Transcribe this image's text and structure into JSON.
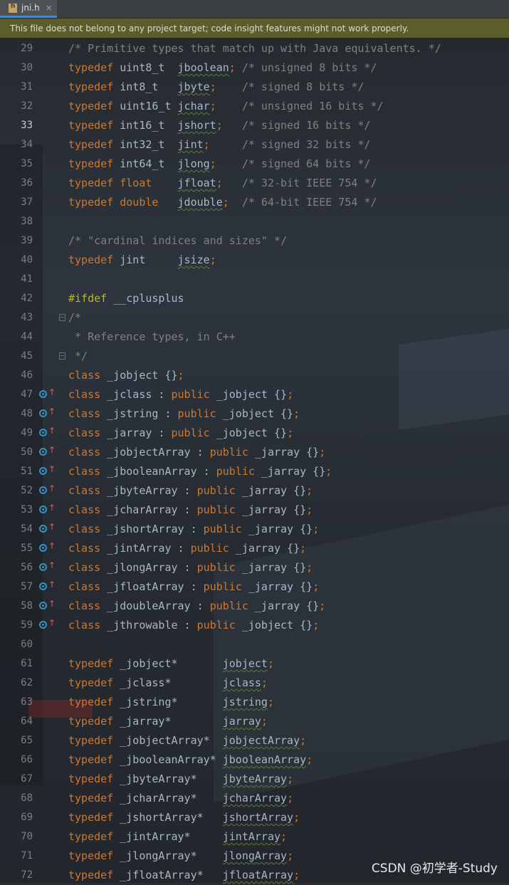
{
  "tab": {
    "title": "jni.h",
    "close": "×"
  },
  "banner": {
    "text": "This file does not belong to any project target; code insight features might not work properly."
  },
  "watermark": "CSDN @初学者-Study",
  "current_line": 33,
  "lines": [
    {
      "n": "29",
      "parts": [
        [
          "cm",
          "/* Primitive types that match up with Java equivalents. */"
        ]
      ]
    },
    {
      "n": "30",
      "parts": [
        [
          "kw",
          "typedef"
        ],
        [
          "ty",
          " uint8_t  "
        ],
        [
          "id",
          "jboolean"
        ],
        [
          "semi",
          ";"
        ],
        [
          "cm",
          " /* unsigned 8 bits */"
        ]
      ]
    },
    {
      "n": "31",
      "parts": [
        [
          "kw",
          "typedef"
        ],
        [
          "ty",
          " int8_t   "
        ],
        [
          "id",
          "jbyte"
        ],
        [
          "semi",
          ";"
        ],
        [
          "cm",
          "    /* signed 8 bits */"
        ]
      ]
    },
    {
      "n": "32",
      "parts": [
        [
          "kw",
          "typedef"
        ],
        [
          "ty",
          " uint16_t "
        ],
        [
          "id",
          "jchar"
        ],
        [
          "semi",
          ";"
        ],
        [
          "cm",
          "    /* unsigned 16 bits */"
        ]
      ]
    },
    {
      "n": "33",
      "parts": [
        [
          "kw",
          "typedef"
        ],
        [
          "ty",
          " int16_t  "
        ],
        [
          "id",
          "jshort"
        ],
        [
          "semi",
          ";"
        ],
        [
          "cm",
          "   /* signed 16 bits */"
        ]
      ]
    },
    {
      "n": "34",
      "parts": [
        [
          "kw",
          "typedef"
        ],
        [
          "ty",
          " int32_t  "
        ],
        [
          "id",
          "jint"
        ],
        [
          "semi",
          ";"
        ],
        [
          "cm",
          "     /* signed 32 bits */"
        ]
      ]
    },
    {
      "n": "35",
      "parts": [
        [
          "kw",
          "typedef"
        ],
        [
          "ty",
          " int64_t  "
        ],
        [
          "id",
          "jlong"
        ],
        [
          "semi",
          ";"
        ],
        [
          "cm",
          "    /* signed 64 bits */"
        ]
      ]
    },
    {
      "n": "36",
      "parts": [
        [
          "kw",
          "typedef"
        ],
        [
          "kw",
          " float    "
        ],
        [
          "id",
          "jfloat"
        ],
        [
          "semi",
          ";"
        ],
        [
          "cm",
          "   /* 32-bit IEEE 754 */"
        ]
      ]
    },
    {
      "n": "37",
      "parts": [
        [
          "kw",
          "typedef"
        ],
        [
          "kw",
          " double   "
        ],
        [
          "id",
          "jdouble"
        ],
        [
          "semi",
          ";"
        ],
        [
          "cm",
          "  /* 64-bit IEEE 754 */"
        ]
      ]
    },
    {
      "n": "38",
      "parts": []
    },
    {
      "n": "39",
      "parts": [
        [
          "cm",
          "/* \"cardinal indices and sizes\" */"
        ]
      ]
    },
    {
      "n": "40",
      "parts": [
        [
          "kw",
          "typedef"
        ],
        [
          "ty",
          " jint     "
        ],
        [
          "id",
          "jsize"
        ],
        [
          "semi",
          ";"
        ]
      ]
    },
    {
      "n": "41",
      "parts": []
    },
    {
      "n": "42",
      "parts": [
        [
          "pp",
          "#ifdef"
        ],
        [
          "ty",
          " __cplusplus"
        ]
      ]
    },
    {
      "n": "43",
      "fold": true,
      "parts": [
        [
          "cm",
          "/*"
        ]
      ]
    },
    {
      "n": "44",
      "parts": [
        [
          "cm",
          " * Reference types, in C++"
        ]
      ]
    },
    {
      "n": "45",
      "fold": true,
      "parts": [
        [
          "cm",
          " */"
        ]
      ]
    },
    {
      "n": "46",
      "parts": [
        [
          "kw",
          "class"
        ],
        [
          "ty",
          " _jobject {}"
        ],
        [
          "semi",
          ";"
        ]
      ]
    },
    {
      "n": "47",
      "impl": true,
      "parts": [
        [
          "kw",
          "class"
        ],
        [
          "ty",
          " _jclass : "
        ],
        [
          "kw",
          "public"
        ],
        [
          "ty",
          " _jobject {}"
        ],
        [
          "semi",
          ";"
        ]
      ]
    },
    {
      "n": "48",
      "impl": true,
      "parts": [
        [
          "kw",
          "class"
        ],
        [
          "ty",
          " _jstring : "
        ],
        [
          "kw",
          "public"
        ],
        [
          "ty",
          " _jobject {}"
        ],
        [
          "semi",
          ";"
        ]
      ]
    },
    {
      "n": "49",
      "impl": true,
      "parts": [
        [
          "kw",
          "class"
        ],
        [
          "ty",
          " _jarray : "
        ],
        [
          "kw",
          "public"
        ],
        [
          "ty",
          " _jobject {}"
        ],
        [
          "semi",
          ";"
        ]
      ]
    },
    {
      "n": "50",
      "impl": true,
      "parts": [
        [
          "kw",
          "class"
        ],
        [
          "ty",
          " _jobjectArray : "
        ],
        [
          "kw",
          "public"
        ],
        [
          "ty",
          " _jarray {}"
        ],
        [
          "semi",
          ";"
        ]
      ]
    },
    {
      "n": "51",
      "impl": true,
      "parts": [
        [
          "kw",
          "class"
        ],
        [
          "ty",
          " _jbooleanArray : "
        ],
        [
          "kw",
          "public"
        ],
        [
          "ty",
          " _jarray {}"
        ],
        [
          "semi",
          ";"
        ]
      ]
    },
    {
      "n": "52",
      "impl": true,
      "parts": [
        [
          "kw",
          "class"
        ],
        [
          "ty",
          " _jbyteArray : "
        ],
        [
          "kw",
          "public"
        ],
        [
          "ty",
          " _jarray {}"
        ],
        [
          "semi",
          ";"
        ]
      ]
    },
    {
      "n": "53",
      "impl": true,
      "parts": [
        [
          "kw",
          "class"
        ],
        [
          "ty",
          " _jcharArray : "
        ],
        [
          "kw",
          "public"
        ],
        [
          "ty",
          " _jarray {}"
        ],
        [
          "semi",
          ";"
        ]
      ]
    },
    {
      "n": "54",
      "impl": true,
      "parts": [
        [
          "kw",
          "class"
        ],
        [
          "ty",
          " _jshortArray : "
        ],
        [
          "kw",
          "public"
        ],
        [
          "ty",
          " _jarray {}"
        ],
        [
          "semi",
          ";"
        ]
      ]
    },
    {
      "n": "55",
      "impl": true,
      "parts": [
        [
          "kw",
          "class"
        ],
        [
          "ty",
          " _jintArray : "
        ],
        [
          "kw",
          "public"
        ],
        [
          "ty",
          " _jarray {}"
        ],
        [
          "semi",
          ";"
        ]
      ]
    },
    {
      "n": "56",
      "impl": true,
      "parts": [
        [
          "kw",
          "class"
        ],
        [
          "ty",
          " _jlongArray : "
        ],
        [
          "kw",
          "public"
        ],
        [
          "ty",
          " _jarray {}"
        ],
        [
          "semi",
          ";"
        ]
      ]
    },
    {
      "n": "57",
      "impl": true,
      "parts": [
        [
          "kw",
          "class"
        ],
        [
          "ty",
          " _jfloatArray : "
        ],
        [
          "kw",
          "public"
        ],
        [
          "ty",
          " _jarray {}"
        ],
        [
          "semi",
          ";"
        ]
      ]
    },
    {
      "n": "58",
      "impl": true,
      "parts": [
        [
          "kw",
          "class"
        ],
        [
          "ty",
          " _jdoubleArray : "
        ],
        [
          "kw",
          "public"
        ],
        [
          "ty",
          " _jarray {}"
        ],
        [
          "semi",
          ";"
        ]
      ]
    },
    {
      "n": "59",
      "impl": true,
      "parts": [
        [
          "kw",
          "class"
        ],
        [
          "ty",
          " _jthrowable : "
        ],
        [
          "kw",
          "public"
        ],
        [
          "ty",
          " _jobject {}"
        ],
        [
          "semi",
          ";"
        ]
      ]
    },
    {
      "n": "60",
      "parts": []
    },
    {
      "n": "61",
      "parts": [
        [
          "kw",
          "typedef"
        ],
        [
          "ty",
          " _jobject*       "
        ],
        [
          "id",
          "jobject"
        ],
        [
          "semi",
          ";"
        ]
      ]
    },
    {
      "n": "62",
      "parts": [
        [
          "kw",
          "typedef"
        ],
        [
          "ty",
          " _jclass*        "
        ],
        [
          "id",
          "jclass"
        ],
        [
          "semi",
          ";"
        ]
      ]
    },
    {
      "n": "63",
      "parts": [
        [
          "kw",
          "typedef"
        ],
        [
          "ty",
          " _jstring*       "
        ],
        [
          "id",
          "jstring"
        ],
        [
          "semi",
          ";"
        ]
      ]
    },
    {
      "n": "64",
      "parts": [
        [
          "kw",
          "typedef"
        ],
        [
          "ty",
          " _jarray*        "
        ],
        [
          "id",
          "jarray"
        ],
        [
          "semi",
          ";"
        ]
      ]
    },
    {
      "n": "65",
      "parts": [
        [
          "kw",
          "typedef"
        ],
        [
          "ty",
          " _jobjectArray*  "
        ],
        [
          "id",
          "jobjectArray"
        ],
        [
          "semi",
          ";"
        ]
      ]
    },
    {
      "n": "66",
      "parts": [
        [
          "kw",
          "typedef"
        ],
        [
          "ty",
          " _jbooleanArray* "
        ],
        [
          "id",
          "jbooleanArray"
        ],
        [
          "semi",
          ";"
        ]
      ]
    },
    {
      "n": "67",
      "parts": [
        [
          "kw",
          "typedef"
        ],
        [
          "ty",
          " _jbyteArray*    "
        ],
        [
          "id",
          "jbyteArray"
        ],
        [
          "semi",
          ";"
        ]
      ]
    },
    {
      "n": "68",
      "parts": [
        [
          "kw",
          "typedef"
        ],
        [
          "ty",
          " _jcharArray*    "
        ],
        [
          "id",
          "jcharArray"
        ],
        [
          "semi",
          ";"
        ]
      ]
    },
    {
      "n": "69",
      "parts": [
        [
          "kw",
          "typedef"
        ],
        [
          "ty",
          " _jshortArray*   "
        ],
        [
          "id",
          "jshortArray"
        ],
        [
          "semi",
          ";"
        ]
      ]
    },
    {
      "n": "70",
      "parts": [
        [
          "kw",
          "typedef"
        ],
        [
          "ty",
          " _jintArray*     "
        ],
        [
          "id",
          "jintArray"
        ],
        [
          "semi",
          ";"
        ]
      ]
    },
    {
      "n": "71",
      "parts": [
        [
          "kw",
          "typedef"
        ],
        [
          "ty",
          " _jlongArray*    "
        ],
        [
          "id",
          "jlongArray"
        ],
        [
          "semi",
          ";"
        ]
      ]
    },
    {
      "n": "72",
      "parts": [
        [
          "kw",
          "typedef"
        ],
        [
          "ty",
          " _jfloatArray*   "
        ],
        [
          "id",
          "jfloatArray"
        ],
        [
          "semi",
          ";"
        ]
      ]
    }
  ]
}
